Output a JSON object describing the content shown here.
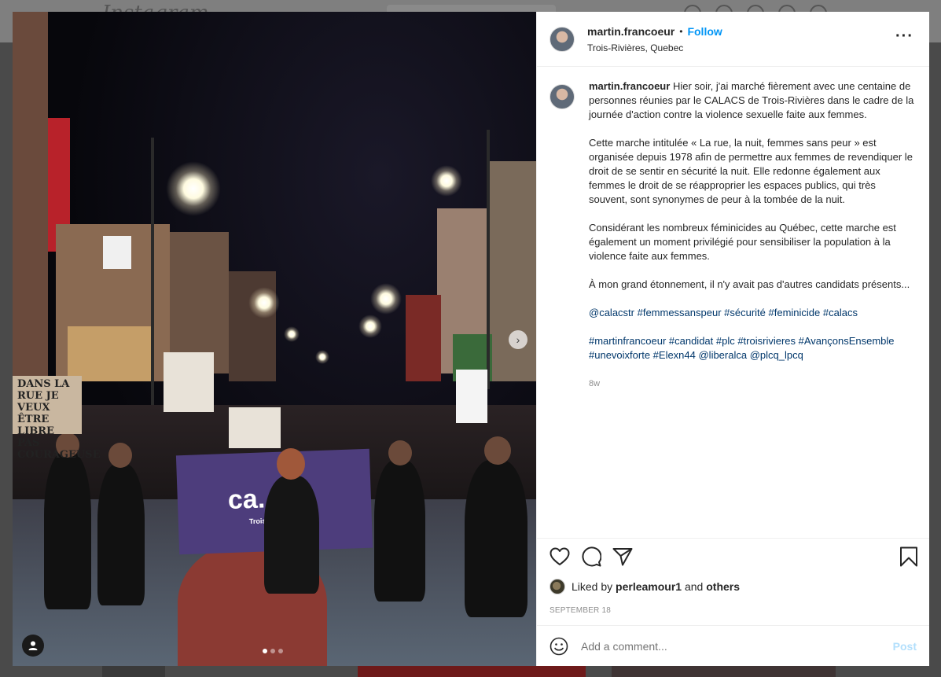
{
  "background": {
    "logo_text": "Instagram"
  },
  "post": {
    "author": {
      "username": "martin.francoeur",
      "follow_label": "Follow",
      "separator": "•",
      "location": "Trois-Rivières, Quebec"
    },
    "caption": {
      "username": "martin.francoeur",
      "paragraph_1": "Hier soir, j'ai marché fièrement avec une centaine de personnes réunies par le CALACS de Trois-Rivières dans le cadre de la journée d'action contre la violence sexuelle faite aux femmes.",
      "paragraph_2": "Cette marche intitulée « La rue, la nuit, femmes sans peur » est organisée depuis 1978 afin de permettre aux femmes de revendiquer le droit de se sentir en sécurité la nuit. Elle redonne également aux femmes le droit de se réapproprier les espaces publics, qui très souvent, sont synonymes de peur à la tombée de la nuit.",
      "paragraph_3": "Considérant les nombreux féminicides au Québec, cette marche est également un moment privilégié pour sensibiliser la population à la violence faite aux femmes.",
      "paragraph_4": "À mon grand étonnement, il n'y avait pas d'autres candidats présents...",
      "hashtags_1": "@calacstr #femmessanspeur #sécurité #feminicide #calacs",
      "hashtags_2": "#martinfrancoeur #candidat #plc #troisrivieres #AvançonsEnsemble #unevoixforte #Elexn44 @liberalca @plcq_lpcq",
      "time_ago": "8w"
    },
    "likes": {
      "prefix": "Liked by",
      "user": "perleamour1",
      "connector": "and",
      "others": "others"
    },
    "date": "SEPTEMBER 18",
    "comment": {
      "placeholder": "Add a comment...",
      "post_label": "Post"
    },
    "photo": {
      "banner_text": "ca.",
      "banner_sub": "Trois",
      "sign_text": "DANS LA RUE JE VEUX ÊTRE LIBRE PAS COURAGEUSE",
      "slide_count": 3,
      "active_slide": 1
    }
  },
  "icons": {
    "like": "heart-icon",
    "comment": "comment-bubble-icon",
    "share": "paper-plane-icon",
    "save": "bookmark-icon",
    "more": "more-options-icon",
    "emoji": "emoji-smile-icon",
    "tag_user": "user-tag-icon",
    "next": "chevron-right-icon"
  },
  "colors": {
    "accent_blue": "#0095f6",
    "hashtag_blue": "#00376b",
    "post_disabled": "#b2dffc",
    "banner_purple": "#4d3d7c"
  }
}
